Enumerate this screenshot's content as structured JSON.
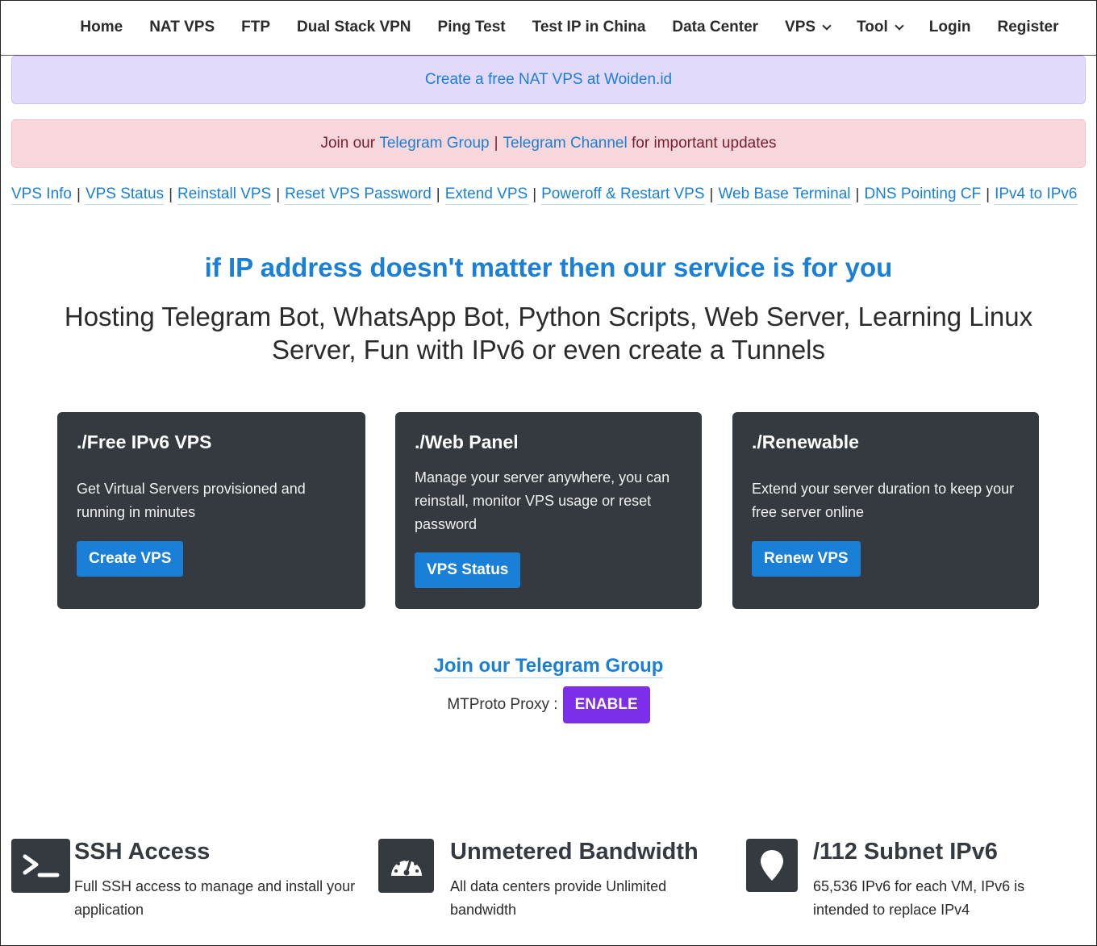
{
  "nav": {
    "items": [
      "Home",
      "NAT VPS",
      "FTP",
      "Dual Stack VPN",
      "Ping Test",
      "Test IP in China",
      "Data Center"
    ],
    "vps": "VPS",
    "tool": "Tool",
    "login": "Login",
    "register": "Register"
  },
  "alerts": {
    "promo_link": "Create a free NAT VPS at Woiden.id",
    "telegram_prefix": "Join our",
    "telegram_group": "Telegram Group",
    "separator": "|",
    "telegram_channel": "Telegram Channel",
    "telegram_suffix": "for important updates"
  },
  "quick_links": [
    "VPS Info",
    "VPS Status",
    "Reinstall VPS",
    "Reset VPS Password",
    "Extend VPS",
    "Poweroff & Restart VPS",
    "Web Base Terminal",
    "DNS Pointing CF",
    "IPv4 to IPv6"
  ],
  "hero": {
    "title": "if IP address doesn't matter then our service is for you",
    "subtitle": "Hosting Telegram Bot, WhatsApp Bot, Python Scripts, Web Server, Learning Linux Server, Fun with IPv6 or even create a Tunnels"
  },
  "cards": [
    {
      "title": "./Free IPv6 VPS",
      "text": "Get Virtual Servers provisioned and running in minutes",
      "button": "Create VPS"
    },
    {
      "title": "./Web Panel",
      "text": "Manage your server anywhere, you can reinstall, monitor VPS usage or reset password",
      "button": "VPS Status"
    },
    {
      "title": "./Renewable",
      "text": "Extend your server duration to keep your free server online",
      "button": "Renew VPS"
    }
  ],
  "join": {
    "link": "Join our Telegram Group",
    "proxy_label": "MTProto Proxy :",
    "proxy_button": "ENABLE"
  },
  "features": [
    {
      "icon": "terminal-icon",
      "title": "SSH Access",
      "text": "Full SSH access to manage and install your application"
    },
    {
      "icon": "speedometer-icon",
      "title": "Unmetered Bandwidth",
      "text": "All data centers provide Unlimited bandwidth"
    },
    {
      "icon": "map-pin-icon",
      "title": "/112 Subnet IPv6",
      "text": "65,536 IPv6 for each VM, IPv6 is intended to replace IPv4"
    }
  ],
  "colors": {
    "link": "#1a7fd6",
    "card_bg": "#343a40",
    "enable_button": "#7d2ee8",
    "alert_purple": "#e2d9fb",
    "alert_red": "#f8d7dc"
  }
}
